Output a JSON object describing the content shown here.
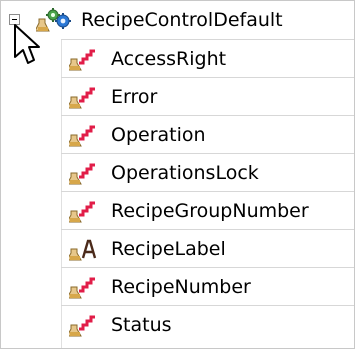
{
  "tree": {
    "root": {
      "label": "RecipeControlDefault",
      "expander": "collapse-icon",
      "icons": [
        "flask-icon",
        "gears-icon"
      ]
    },
    "items": [
      {
        "label": "AccessRight",
        "icon": "signal-variable-icon"
      },
      {
        "label": "Error",
        "icon": "signal-variable-icon"
      },
      {
        "label": "Operation",
        "icon": "signal-variable-icon"
      },
      {
        "label": "OperationsLock",
        "icon": "signal-variable-icon"
      },
      {
        "label": "RecipeGroupNumber",
        "icon": "signal-variable-icon"
      },
      {
        "label": "RecipeLabel",
        "icon": "text-variable-icon"
      },
      {
        "label": "RecipeNumber",
        "icon": "signal-variable-icon"
      },
      {
        "label": "Status",
        "icon": "signal-variable-icon"
      }
    ]
  }
}
